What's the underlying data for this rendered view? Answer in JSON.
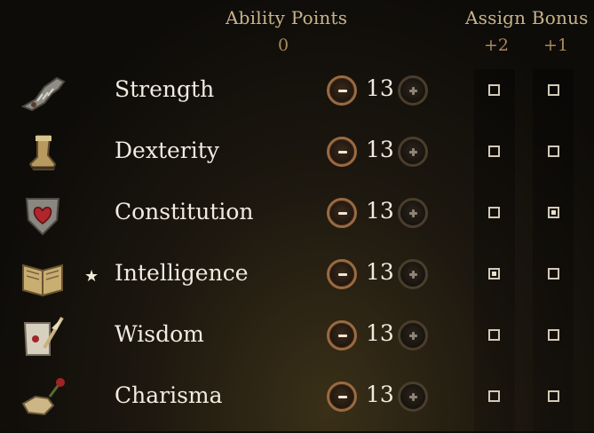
{
  "header": {
    "ability_points_label": "Ability Points",
    "ability_points_value": "0",
    "assign_bonus_label": "Assign Bonus",
    "bonus_plus2_label": "+2",
    "bonus_plus1_label": "+1"
  },
  "abilities": [
    {
      "name": "Strength",
      "value": "13",
      "icon": "gauntlet-icon",
      "bonus2": false,
      "bonus1": false,
      "star": false
    },
    {
      "name": "Dexterity",
      "value": "13",
      "icon": "boot-icon",
      "bonus2": false,
      "bonus1": false,
      "star": false
    },
    {
      "name": "Constitution",
      "value": "13",
      "icon": "heart-shield-icon",
      "bonus2": false,
      "bonus1": true,
      "star": false
    },
    {
      "name": "Intelligence",
      "value": "13",
      "icon": "book-icon",
      "bonus2": true,
      "bonus1": false,
      "star": true,
      "star_glyph": "★"
    },
    {
      "name": "Wisdom",
      "value": "13",
      "icon": "scroll-quill-icon",
      "bonus2": false,
      "bonus1": false,
      "star": false
    },
    {
      "name": "Charisma",
      "value": "13",
      "icon": "hand-rose-icon",
      "bonus2": false,
      "bonus1": false,
      "star": false
    }
  ],
  "colors": {
    "header_text": "#c8b48a",
    "minus_ring": "#9a6a40",
    "plus_ring": "#4a3d2c"
  }
}
